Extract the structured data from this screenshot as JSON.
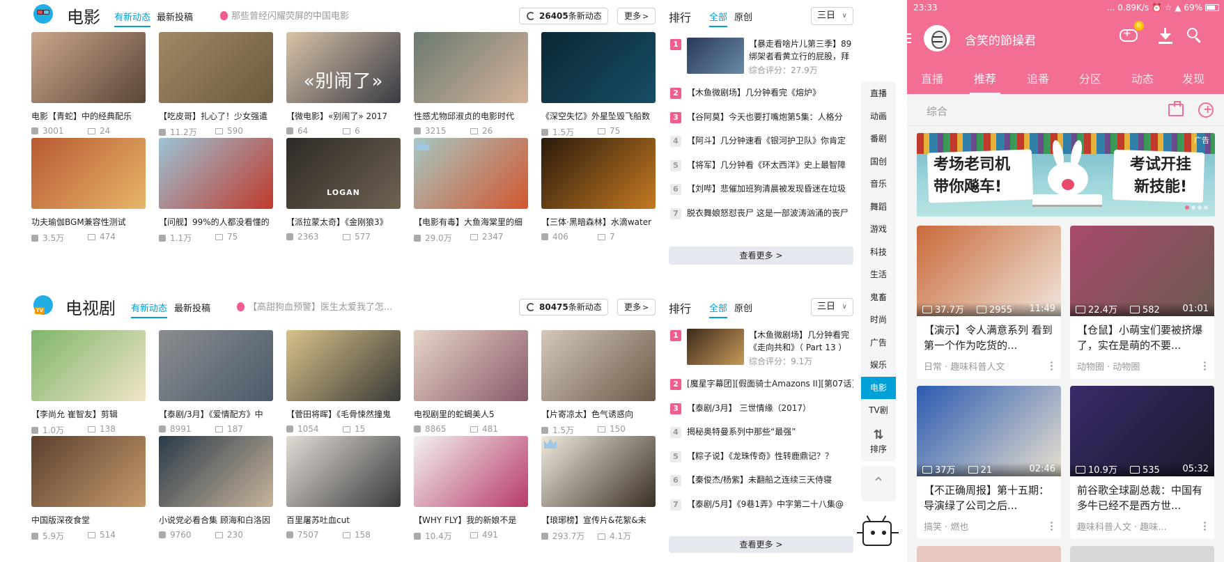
{
  "movie": {
    "title": "电影",
    "tabs": [
      "有新动态",
      "最新投稿"
    ],
    "hot": "那些曾经闪耀荧屏的中国电影",
    "new_count": "26405",
    "new_label": "条新动态",
    "more": "更多",
    "videos": [
      {
        "title": "电影【青蛇】中的经典配乐",
        "plays": "3001",
        "danmaku": "24",
        "colors": [
          "#caa68d",
          "#5a4535"
        ]
      },
      {
        "title": "【吃皮哥】扎心了！少女强遣",
        "plays": "11.2万",
        "danmaku": "590",
        "colors": [
          "#a08864",
          "#6b5a3e"
        ]
      },
      {
        "title": "【微电影】«别闹了» 2017",
        "plays": "64",
        "danmaku": "6",
        "colors": [
          "#d8c3a8",
          "#3a3a44"
        ],
        "overlay": "«别闹了»"
      },
      {
        "title": "性感尤物邱淑贞的电影时代",
        "plays": "3215",
        "danmaku": "26",
        "colors": [
          "#6a7a70",
          "#d4b29a"
        ]
      },
      {
        "title": "《深空失忆》外星坠毁飞船数",
        "plays": "1.5万",
        "danmaku": "75",
        "colors": [
          "#0b2733",
          "#174e66"
        ]
      },
      {
        "title": "功夫瑜伽BGM兼容性测试",
        "plays": "3.5万",
        "danmaku": "474",
        "colors": [
          "#b85a30",
          "#e8b66c"
        ]
      },
      {
        "title": "【问舰】99%的人都没看懂的",
        "plays": "1.1万",
        "danmaku": "75",
        "colors": [
          "#9cc3d6",
          "#c0392b"
        ]
      },
      {
        "title": "【派拉蒙太奇】《金刚狼3》",
        "plays": "2363",
        "danmaku": "577",
        "colors": [
          "#2e2a26",
          "#6e6252"
        ],
        "overlay": "LOGAN"
      },
      {
        "title": "【电影有毒】大鱼海棠里的细",
        "plays": "29.0万",
        "danmaku": "2347",
        "colors": [
          "#a7c7c2",
          "#d3562f"
        ],
        "crown": true
      },
      {
        "title": "【三体·黑暗森林】水滴water",
        "plays": "406",
        "danmaku": "7",
        "colors": [
          "#2a1a0c",
          "#c47a22"
        ]
      }
    ],
    "rank": {
      "title": "排行",
      "tabs": [
        "全部",
        "原创"
      ],
      "period": "三日",
      "top_title": "【暴走看啥片儿第三季】89 绑架者看黄立行的屁股，拜",
      "top_score": "综合评分：27.9万",
      "items": [
        "【木鱼微剧场】几分钟看完《熔炉》",
        "【谷阿莫】今天也要打嘴炮第5集：人格分",
        "【阿斗】几分钟速看《银河护卫队》你肯定",
        "【将军】几分钟看《环太西洋》史上最智障",
        "【刘哔】悲催加班狗清晨被发现昏迷在垃圾",
        "脱衣舞娘怒怼丧尸 这是一部波涛汹涌的丧尸"
      ],
      "more": "查看更多"
    }
  },
  "tvshow": {
    "title": "电视剧",
    "tabs": [
      "有新动态",
      "最新投稿"
    ],
    "hot": "【高甜狗血预警】医生太爱我了怎...",
    "new_count": "80475",
    "new_label": "条新动态",
    "more": "更多",
    "videos": [
      {
        "title": "【李尚允 崔智友】剪辑",
        "plays": "1.0万",
        "danmaku": "138",
        "colors": [
          "#7fb56a",
          "#f1e5c8"
        ]
      },
      {
        "title": "【泰剧/3月】《爱情配方》中",
        "plays": "8991",
        "danmaku": "187",
        "colors": [
          "#8a8d90",
          "#4c5a6a"
        ]
      },
      {
        "title": "【菅田将晖】《毛骨悚然撞鬼",
        "plays": "1054",
        "danmaku": "15",
        "colors": [
          "#d8c28a",
          "#3a3a36"
        ]
      },
      {
        "title": "电视剧里的蛇蝎美人5",
        "plays": "8865",
        "danmaku": "481",
        "colors": [
          "#e6d5c8",
          "#8a5a6a"
        ]
      },
      {
        "title": "【片寄凉太】色气诱惑向",
        "plays": "1.5万",
        "danmaku": "150",
        "colors": [
          "#d5c8b8",
          "#6a5a4a"
        ]
      },
      {
        "title": "中国版深夜食堂",
        "plays": "5.9万",
        "danmaku": "514",
        "colors": [
          "#5a4030",
          "#c69a6a"
        ]
      },
      {
        "title": "小说党必看合集 顾海和白洛因",
        "plays": "9760",
        "danmaku": "230",
        "colors": [
          "#2a3a4a",
          "#c8b49a"
        ]
      },
      {
        "title": "百里屠苏吐血cut",
        "plays": "7507",
        "danmaku": "158",
        "colors": [
          "#e2dcd6",
          "#3a3a3a"
        ]
      },
      {
        "title": "【WHY FLY】我的新娘不是",
        "plays": "10.4万",
        "danmaku": "491",
        "colors": [
          "#f2f2f2",
          "#b83a6a"
        ]
      },
      {
        "title": "【琅琊榜】宣传片&花絮&未",
        "plays": "293.7万",
        "danmaku": "4.1万",
        "colors": [
          "#efe9dc",
          "#3a3026"
        ],
        "crown": true
      }
    ],
    "rank": {
      "title": "排行",
      "tabs": [
        "全部",
        "原创"
      ],
      "period": "三日",
      "top_title": "【木鱼微剧场】几分钟看完《走向共和》（ Part 13 ）二",
      "top_score": "综合评分：9.1万",
      "items": [
        "[魔星字幕团][假面骑士Amazons II][第07话]",
        "【泰剧/3月】 三世情缘（2017）",
        "揭秘奥特曼系列中那些“最强”",
        "【粽子说】《龙珠传奇》性转鹿鼎记？？",
        "【秦俊杰/杨紫】未翻船之连续三天侍寝",
        "【泰剧/5月】《9巷1弄》中字第二十八集@"
      ],
      "more": "查看更多"
    }
  },
  "sidenav": {
    "items": [
      "直播",
      "动画",
      "番剧",
      "国创",
      "音乐",
      "舞蹈",
      "游戏",
      "科技",
      "生活",
      "鬼畜",
      "时尚",
      "广告",
      "娱乐",
      "电影",
      "TV剧"
    ],
    "active": "电影",
    "sort_label": "排序"
  },
  "phone": {
    "status": {
      "time": "23:33",
      "right": "... 0.89K/s ⏰ ☆ ▲ 69%"
    },
    "username": "含笑的節操君",
    "badge": "新",
    "tabs": [
      "直播",
      "推荐",
      "追番",
      "分区",
      "动态",
      "发现"
    ],
    "active_tab": "推荐",
    "section": "综合",
    "banner": {
      "left": "考场老司机\n带你飚车!",
      "right": "考试开挂\n新技能!",
      "ad": "广告"
    },
    "cards": [
      {
        "plays": "37.7万",
        "danmaku": "2955",
        "duration": "11:49",
        "title": "【演示】令人满意系列 看到第一个作为吃货的...",
        "tags": "日常 · 趣味科普人文",
        "colors": [
          "#c96a3a",
          "#efe6dc"
        ]
      },
      {
        "plays": "22.4万",
        "danmaku": "582",
        "duration": "01:01",
        "title": "【仓鼠】小萌宝们要被挤爆了，实在是萌的不要...",
        "tags": "动物圈 · 动物圈",
        "colors": [
          "#a94a6a",
          "#6a5a52"
        ]
      },
      {
        "plays": "37万",
        "danmaku": "21",
        "duration": "02:46",
        "title": "【不正确周报】第十五期：导演绿了公司之后...",
        "tags": "搞笑 · 燃也",
        "colors": [
          "#2a5ab0",
          "#e8e0d0"
        ]
      },
      {
        "plays": "10.9万",
        "danmaku": "535",
        "duration": "05:32",
        "title": "前谷歌全球副总裁：中国有多牛已经不是西方世...",
        "tags": "趣味科普人文 · 趣味...",
        "colors": [
          "#3a2a6a",
          "#1a1a2a"
        ]
      }
    ]
  }
}
